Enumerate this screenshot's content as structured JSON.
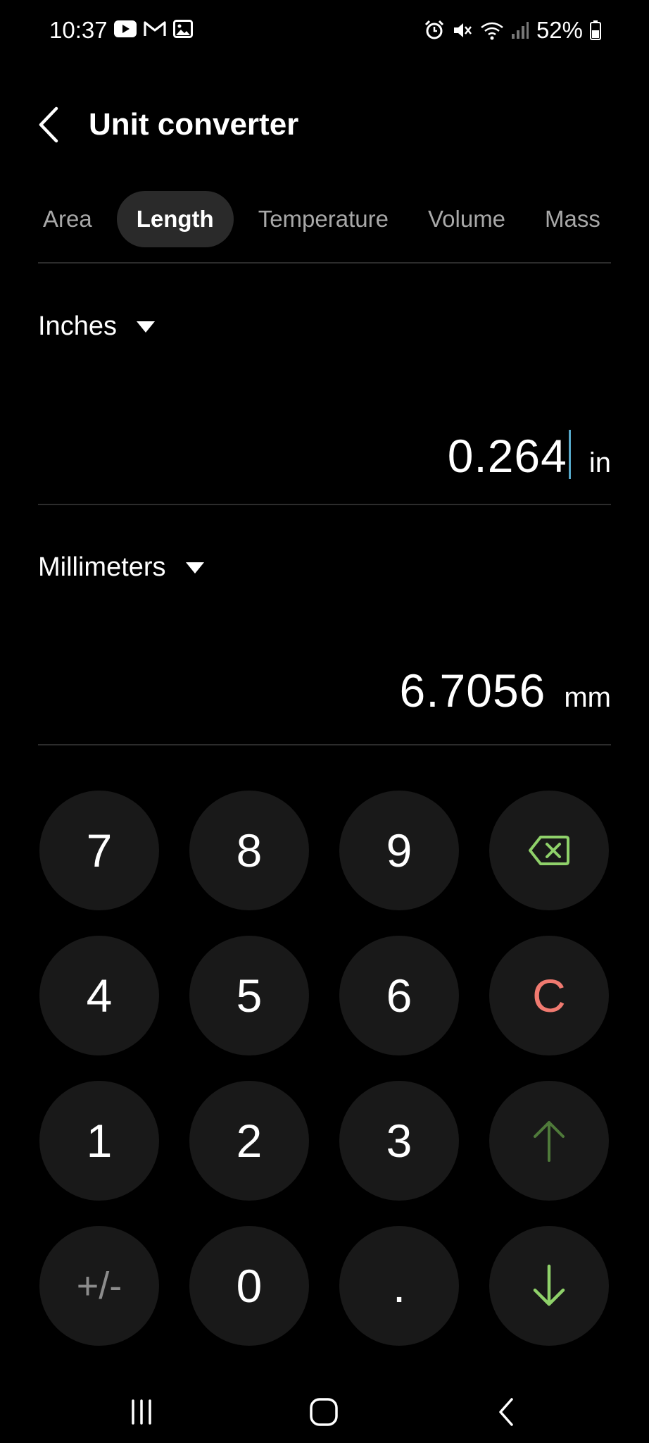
{
  "status_bar": {
    "time": "10:37",
    "battery": "52%",
    "left_icons": [
      "youtube-icon",
      "gmail-icon",
      "gallery-icon"
    ],
    "right_icons": [
      "alarm-icon",
      "mute-icon",
      "wifi-icon",
      "signal-icon",
      "battery-icon"
    ]
  },
  "header": {
    "title": "Unit converter"
  },
  "tabs": [
    {
      "label": "Area",
      "active": false
    },
    {
      "label": "Length",
      "active": true
    },
    {
      "label": "Temperature",
      "active": false
    },
    {
      "label": "Volume",
      "active": false
    },
    {
      "label": "Mass",
      "active": false
    }
  ],
  "from": {
    "unit_name": "Inches",
    "value": "0.264",
    "unit_abbr": "in"
  },
  "to": {
    "unit_name": "Millimeters",
    "value": "6.7056",
    "unit_abbr": "mm"
  },
  "keypad": {
    "keys": [
      "7",
      "8",
      "9",
      "4",
      "5",
      "6",
      "C",
      "1",
      "2",
      "3",
      "+/-",
      "0",
      "."
    ]
  },
  "colors": {
    "background": "#000000",
    "key_background": "#191919",
    "clear_red": "#f07a70",
    "accent_green": "#8fd16a",
    "dim_green": "#4f7a3a",
    "cursor_blue": "#56a7c8"
  }
}
